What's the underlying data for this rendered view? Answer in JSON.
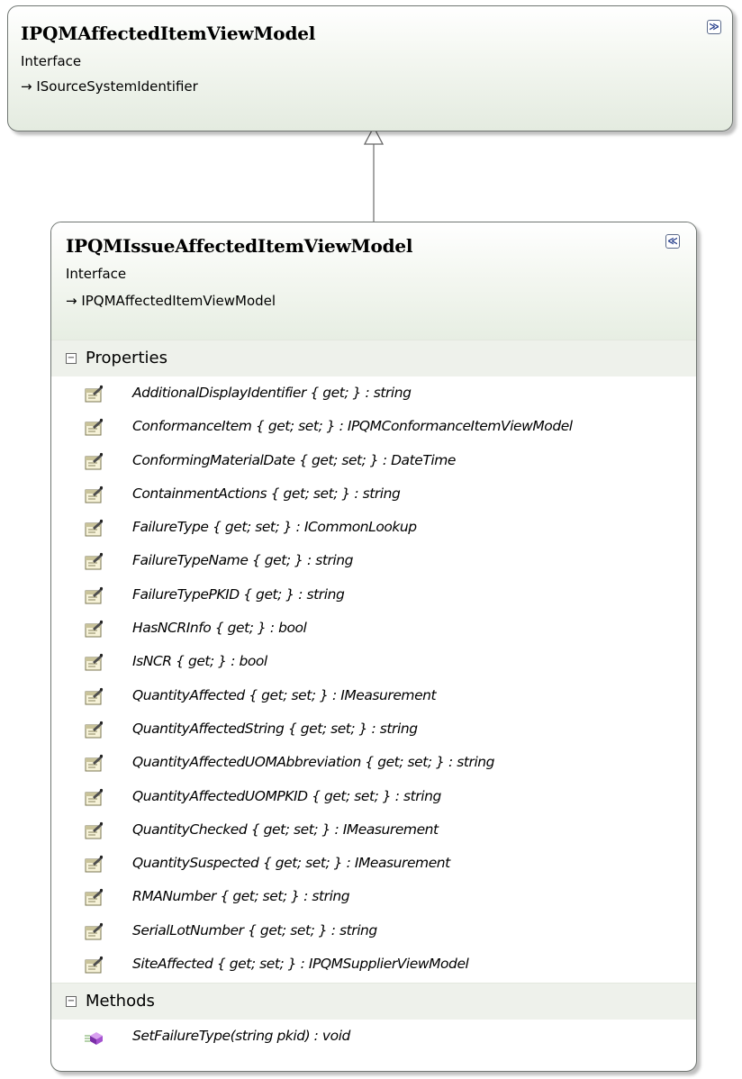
{
  "base": {
    "name": "IPQMAffectedItemViewModel",
    "stereotype": "Interface",
    "inherits": "→ ISourceSystemIdentifier",
    "toggle": "≫"
  },
  "derived": {
    "name": "IPQMIssueAffectedItemViewModel",
    "stereotype": "Interface",
    "inherits": "→ IPQMAffectedItemViewModel",
    "toggle": "≪",
    "properties_label": "Properties",
    "methods_label": "Methods",
    "expander": "−",
    "properties": [
      "AdditionalDisplayIdentifier { get; } : string",
      "ConformanceItem { get; set; } : IPQMConformanceItemViewModel",
      "ConformingMaterialDate { get; set; } : DateTime",
      "ContainmentActions { get; set; } : string",
      "FailureType { get; set; } : ICommonLookup",
      "FailureTypeName { get; } : string",
      "FailureTypePKID { get; } : string",
      "HasNCRInfo { get; } : bool",
      "IsNCR { get; } : bool",
      "QuantityAffected { get; set; } : IMeasurement",
      "QuantityAffectedString { get; set; } : string",
      "QuantityAffectedUOMAbbreviation { get; set; } : string",
      "QuantityAffectedUOMPKID { get; set; } : string",
      "QuantityChecked { get; set; } : IMeasurement",
      "QuantitySuspected { get; set; } : IMeasurement",
      "RMANumber { get; set; } : string",
      "SerialLotNumber { get; set; } : string",
      "SiteAffected { get; set; } : IPQMSupplierViewModel"
    ],
    "methods": [
      "SetFailureType(string pkid) : void"
    ]
  },
  "icons": {
    "property": "property-icon",
    "method": "method-icon",
    "collapse": "chevron-double-up-icon",
    "expand": "chevron-double-down-icon"
  }
}
